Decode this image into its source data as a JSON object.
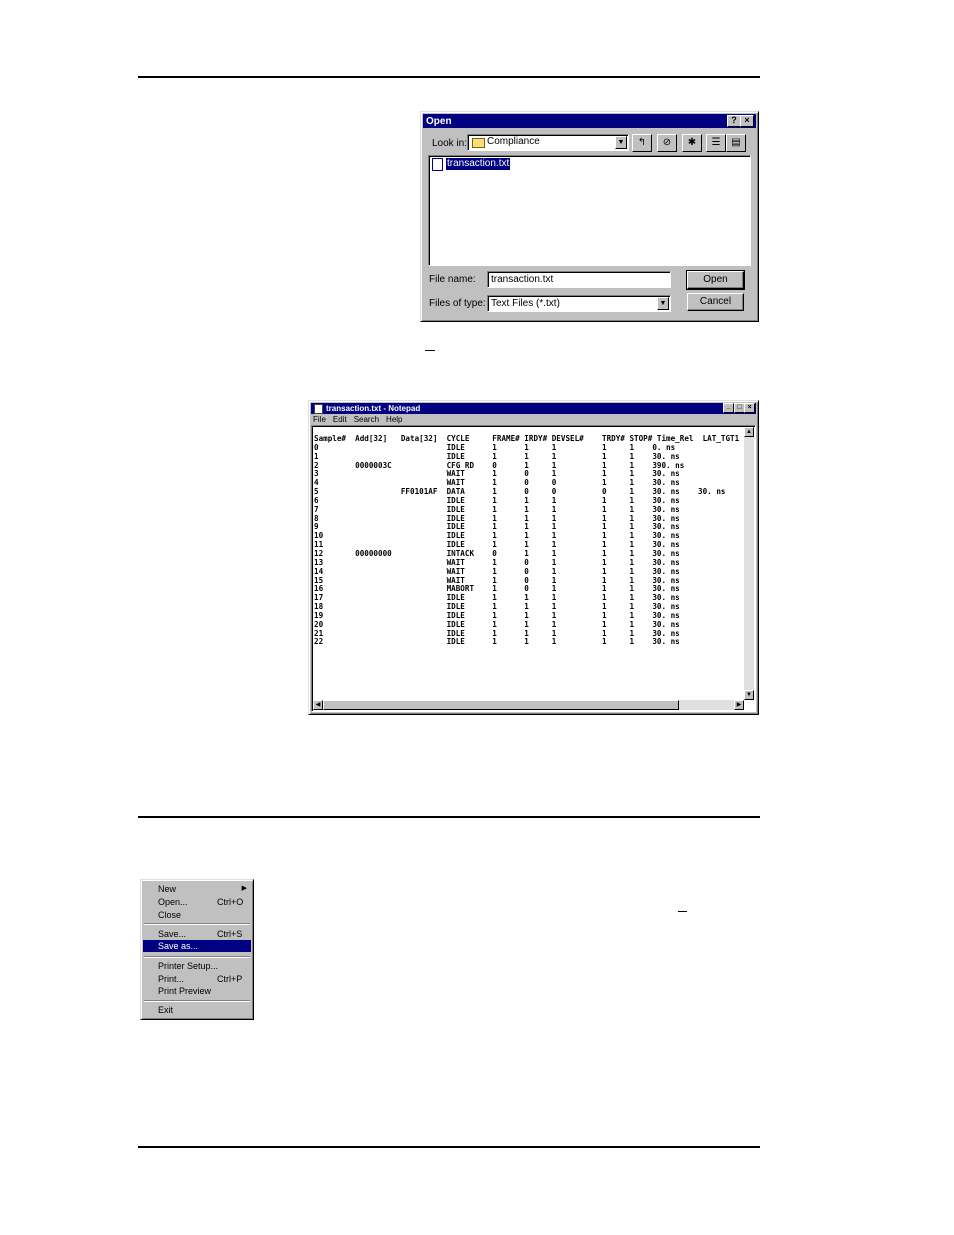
{
  "open_dialog": {
    "title": "Open",
    "help_btn": "?",
    "close_btn": "×",
    "look_in_label": "Look in:",
    "look_in_value": "Compliance",
    "files": [
      "transaction.txt"
    ],
    "file_name_label": "File name:",
    "file_name_value": "transaction.txt",
    "file_type_label": "Files of type:",
    "file_type_value": "Text Files (*.txt)",
    "open_btn": "Open",
    "cancel_btn": "Cancel"
  },
  "notepad": {
    "title": "transaction.txt - Notepad",
    "menus": [
      "File",
      "Edit",
      "Search",
      "Help"
    ],
    "content": "Sample#  Add[32]   Data[32]  CYCLE     FRAME# IRDY# DEVSEL#    TRDY# STOP# Time_Rel  LAT_TGT1\n0                            IDLE      1      1     1          1     1    0. ns\n1                            IDLE      1      1     1          1     1    30. ns\n2        0000003C            CFG RD    0      1     1          1     1    390. ns\n3                            WAIT      1      0     1          1     1    30. ns\n4                            WAIT      1      0     0          1     1    30. ns\n5                  FF0101AF  DATA      1      0     0          0     1    30. ns    30. ns\n6                            IDLE      1      1     1          1     1    30. ns\n7                            IDLE      1      1     1          1     1    30. ns\n8                            IDLE      1      1     1          1     1    30. ns\n9                            IDLE      1      1     1          1     1    30. ns\n10                           IDLE      1      1     1          1     1    30. ns\n11                           IDLE      1      1     1          1     1    30. ns\n12       00000000            INTACK    0      1     1          1     1    30. ns\n13                           WAIT      1      0     1          1     1    30. ns\n14                           WAIT      1      0     1          1     1    30. ns\n15                           WAIT      1      0     1          1     1    30. ns\n16                           MABORT    1      0     1          1     1    30. ns\n17                           IDLE      1      1     1          1     1    30. ns\n18                           IDLE      1      1     1          1     1    30. ns\n19                           IDLE      1      1     1          1     1    30. ns\n20                           IDLE      1      1     1          1     1    30. ns\n21                           IDLE      1      1     1          1     1    30. ns\n22                           IDLE      1      1     1          1     1    30. ns"
  },
  "file_menu": {
    "items": [
      {
        "label": "New",
        "shortcut": ""
      },
      {
        "label": "Open...",
        "shortcut": "Ctrl+O"
      },
      {
        "label": "Close",
        "shortcut": ""
      },
      {
        "label": "Save...",
        "shortcut": "Ctrl+S"
      },
      {
        "label": "Save as...",
        "shortcut": ""
      },
      {
        "label": "Printer Setup...",
        "shortcut": ""
      },
      {
        "label": "Print...",
        "shortcut": "Ctrl+P"
      },
      {
        "label": "Print Preview",
        "shortcut": ""
      },
      {
        "label": "Exit",
        "shortcut": ""
      }
    ],
    "selected": "Save as..."
  }
}
